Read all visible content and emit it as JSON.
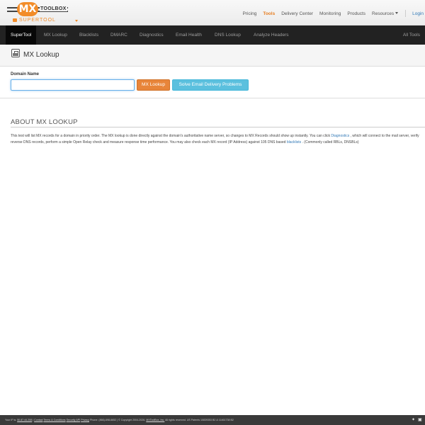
{
  "brand": {
    "logo_mx": "MX",
    "logo_toolbox": "TOOLBOX",
    "sub_label": "SUPERTOOL"
  },
  "topnav": {
    "items": [
      "Pricing",
      "Tools",
      "Delivery Center",
      "Monitoring",
      "Products",
      "Resources"
    ],
    "active": "Tools",
    "login": "Login"
  },
  "tabs": {
    "items": [
      "SuperTool",
      "MX Lookup",
      "Blacklists",
      "DMARC",
      "Diagnostics",
      "Email Health",
      "DNS Lookup",
      "Analyze Headers"
    ],
    "active": "SuperTool",
    "all_tools": "All Tools"
  },
  "page": {
    "title": "MX Lookup"
  },
  "form": {
    "label": "Domain Name",
    "input_value": "",
    "mx_button": "MX Lookup",
    "solve_button": "Solve Email Delivery Problems"
  },
  "about": {
    "heading": "ABOUT MX LOOKUP",
    "text_1": "This test will list MX records for a domain in priority order. The MX lookup is done directly against the domain's authoritative name server, so changes to MX Records should show up instantly. You can click ",
    "link_diagnostics": "Diagnostics",
    "text_2": " , which will connect to the mail server, verify reverse DNS records, perform a simple Open Relay check and measure response time performance. You may also check each MX record (IP Address) against 105 DNS based ",
    "link_blacklists": "blacklists",
    "text_3": " . (Commonly called RBLs, DNSBLs)"
  },
  "footer": {
    "ip_label": "Your IP is: ",
    "ip_value": "50.87.44.208",
    "sep": " | ",
    "contact": "Contact",
    "terms": "Terms & Conditions",
    "site_map": "Security API",
    "privacy": "Privacy",
    "phone": " Phone: (866)-698-6652 | ",
    "copyright": " © Copyright 2004-2026, ",
    "company": "MXToolBox, Inc.",
    "rights": " All rights reserved. US Patents 10839353 B2 & 11461738 B2"
  },
  "colors": {
    "accent": "#e67e22",
    "tabbar_bg": "#222222",
    "info_button": "#5bc0de",
    "link": "#337ab7"
  }
}
